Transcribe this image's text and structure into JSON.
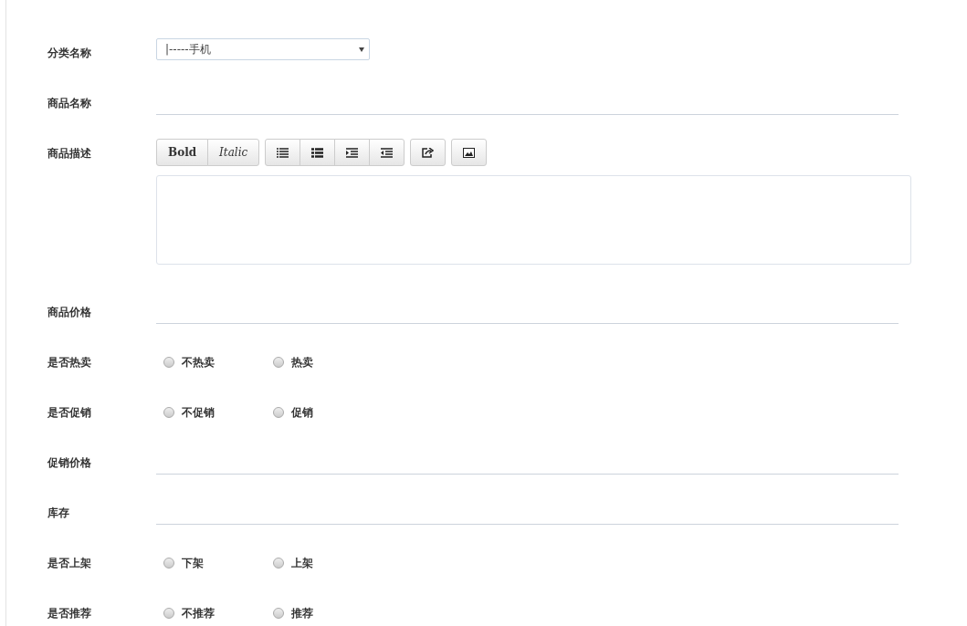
{
  "form": {
    "fields": [
      {
        "kind": "select",
        "label": "分类名称",
        "value": "|-----手机"
      },
      {
        "kind": "text",
        "label": "商品名称"
      },
      {
        "kind": "editor",
        "label": "商品描述",
        "text_buttons": [
          "Bold",
          "Italic"
        ]
      },
      {
        "kind": "text",
        "label": "商品价格"
      },
      {
        "kind": "radio",
        "label": "是否热卖",
        "options": [
          {
            "label": "不热卖",
            "selected": false
          },
          {
            "label": "热卖",
            "selected": false
          }
        ]
      },
      {
        "kind": "radio",
        "label": "是否促销",
        "options": [
          {
            "label": "不促销",
            "selected": false
          },
          {
            "label": "促销",
            "selected": false
          }
        ]
      },
      {
        "kind": "text",
        "label": "促销价格"
      },
      {
        "kind": "text",
        "label": "库存"
      },
      {
        "kind": "radio",
        "label": "是否上架",
        "options": [
          {
            "label": "下架",
            "selected": false
          },
          {
            "label": "上架",
            "selected": false
          }
        ]
      },
      {
        "kind": "radio",
        "label": "是否推荐",
        "options": [
          {
            "label": "不推荐",
            "selected": false
          },
          {
            "label": "推荐",
            "selected": false
          }
        ]
      }
    ]
  }
}
